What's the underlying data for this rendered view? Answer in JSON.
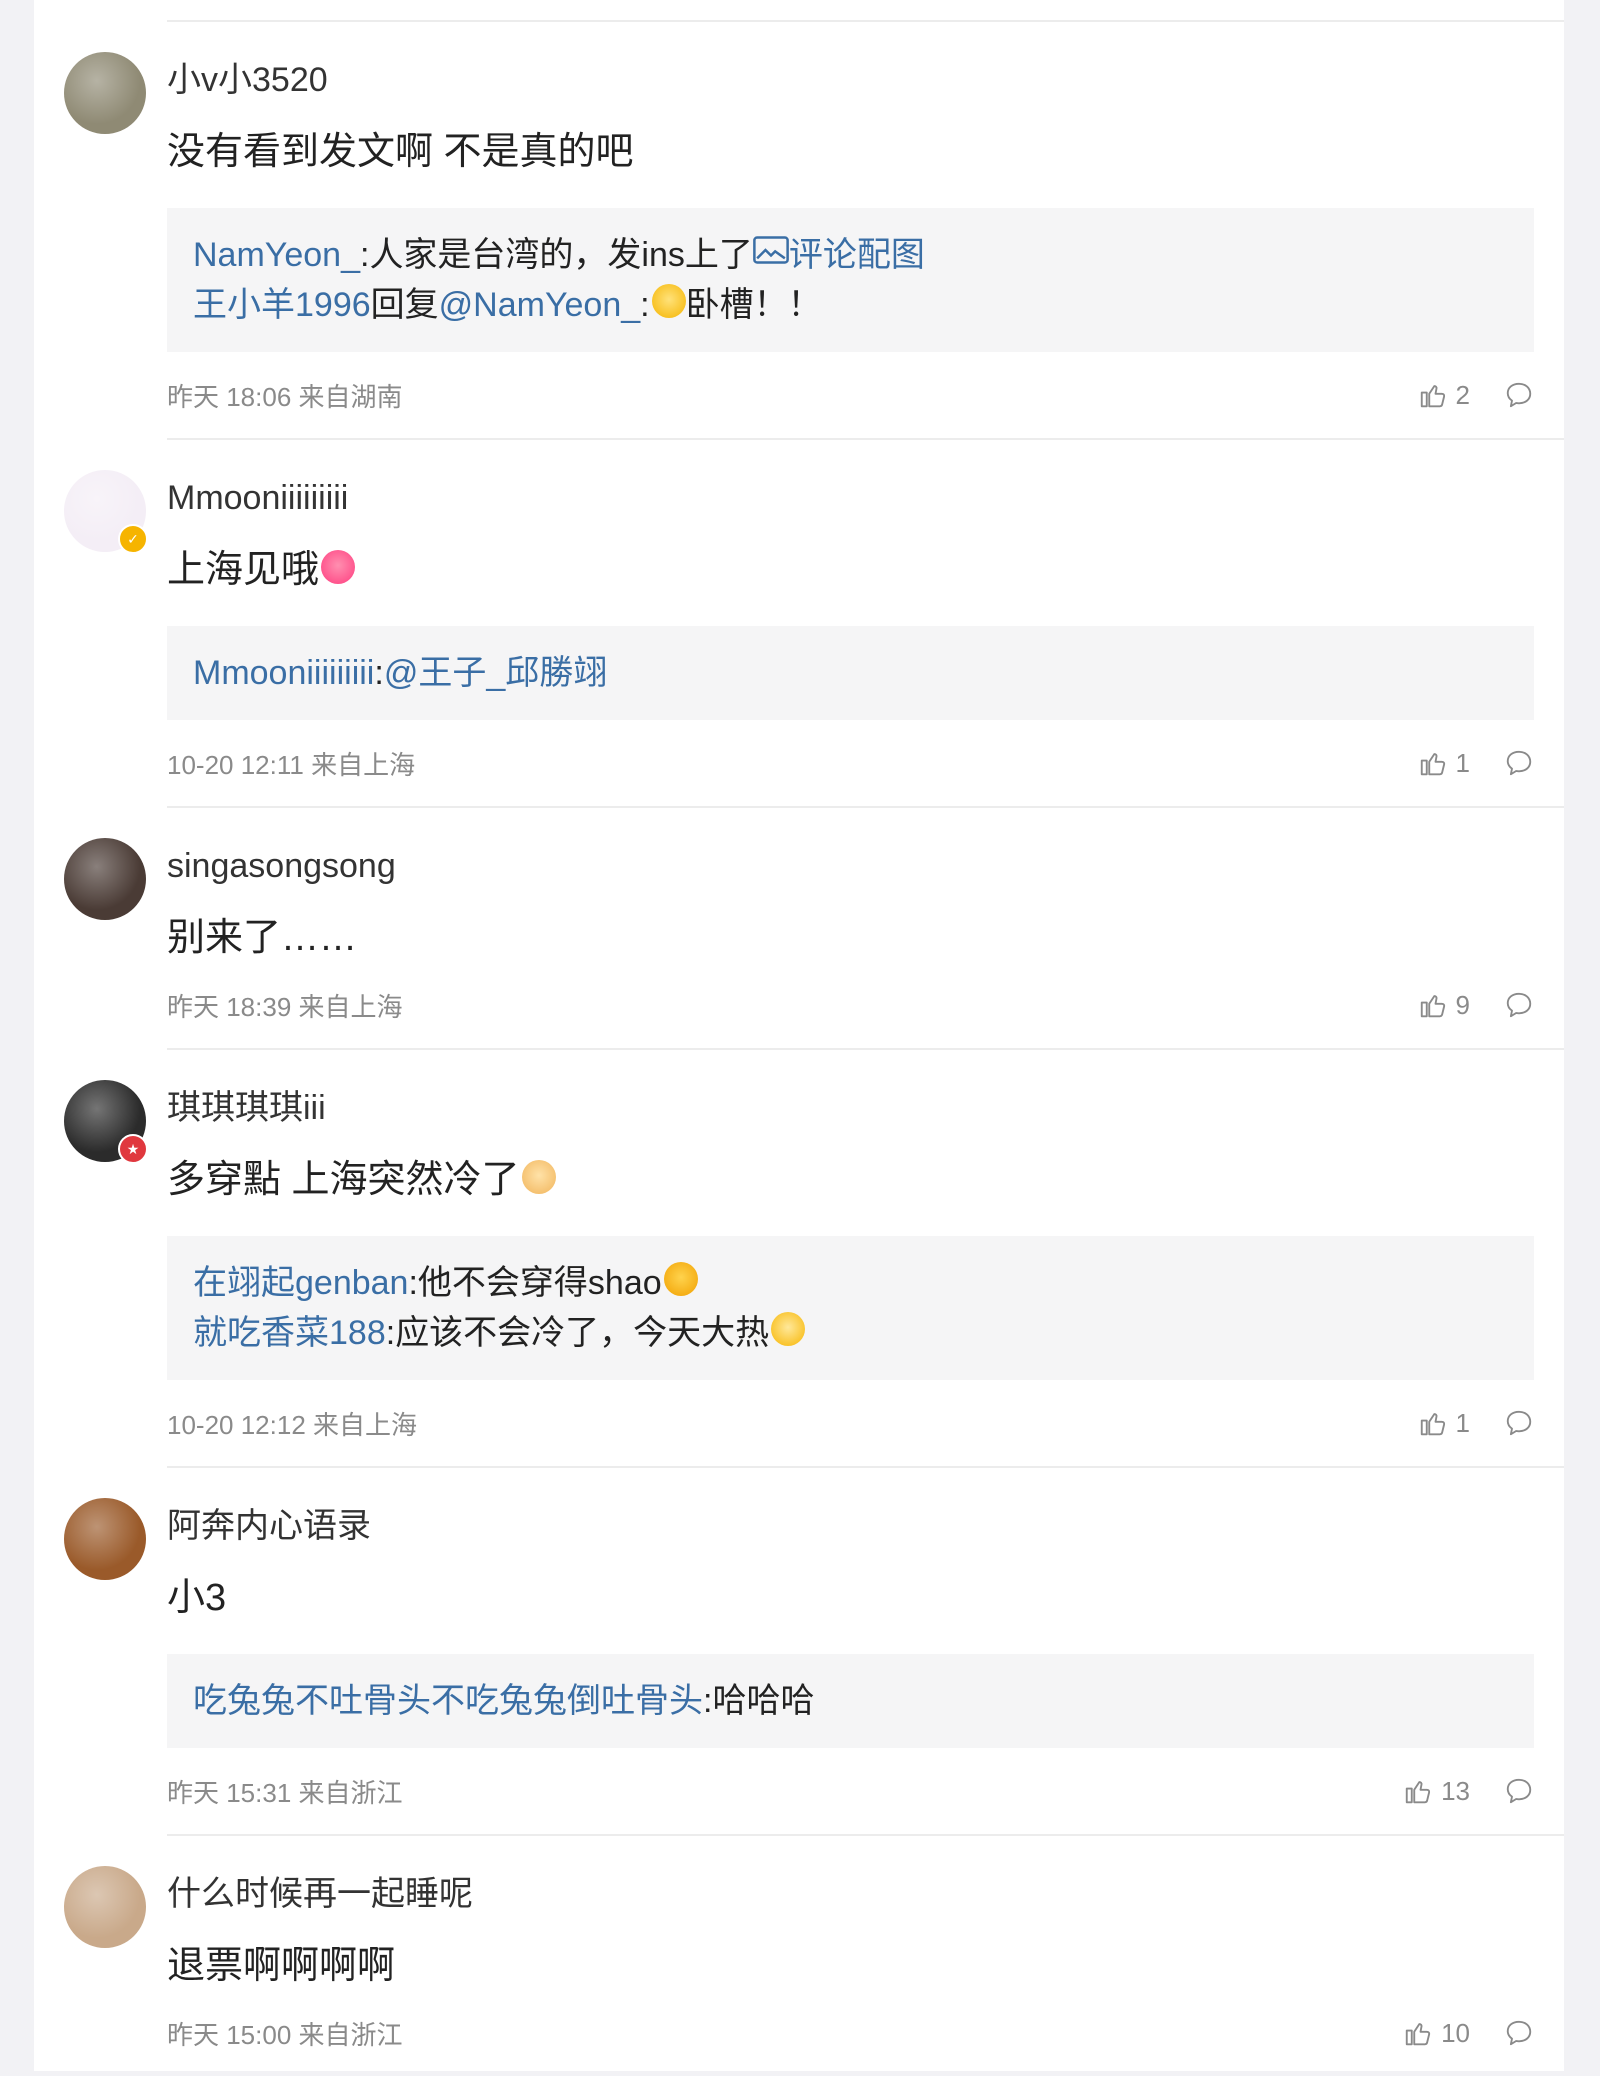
{
  "comments": [
    {
      "username": "小v小3520",
      "content": "没有看到发文啊 不是真的吧",
      "emoji": "",
      "badge": "",
      "avatar_color": "#8f8a74",
      "replies": [
        {
          "name": "NamYeon_",
          "sep": ":",
          "text": "人家是台湾的，发ins上了",
          "image_link": "评论配图",
          "emoji": ""
        },
        {
          "name": "王小羊1996",
          "sep": "",
          "text": "回复",
          "mention": "@NamYeon_",
          "after": ":",
          "emoji": "smile-emoji",
          "tail": "卧槽！！"
        }
      ],
      "time": "昨天 18:06",
      "location": "来自湖南",
      "likes": "2"
    },
    {
      "username": "Mmooniiiiiiiii",
      "content": "上海见哦",
      "emoji": "heart-face-emoji",
      "badge": "gold",
      "avatar_color": "#f4eef6",
      "replies": [
        {
          "name": "Mmooniiiiiiiii",
          "sep": ":",
          "text": "",
          "mention": "@王子_邱勝翊",
          "emoji": ""
        }
      ],
      "time": "10-20 12:11",
      "location": "来自上海",
      "likes": "1"
    },
    {
      "username": "singasongsong",
      "content": "别来了……",
      "emoji": "",
      "badge": "",
      "avatar_color": "#4a3b35",
      "replies": [],
      "time": "昨天 18:39",
      "location": "来自上海",
      "likes": "9"
    },
    {
      "username": "琪琪琪琪iii",
      "content": "多穿點 上海突然冷了",
      "emoji": "dog-emoji",
      "badge": "red",
      "avatar_color": "#2b2b2b",
      "replies": [
        {
          "name": "在翊起genban",
          "sep": ":",
          "text": "他不会穿得shao",
          "emoji": "heart-eyes-emoji"
        },
        {
          "name": "就吃香菜188",
          "sep": ":",
          "text": "应该不会冷了，今天大热",
          "emoji": "star-emoji"
        }
      ],
      "time": "10-20 12:12",
      "location": "来自上海",
      "likes": "1"
    },
    {
      "username": "阿奔内心语录",
      "content": "小3",
      "emoji": "",
      "badge": "",
      "avatar_color": "#9a5a2a",
      "replies": [
        {
          "name": "吃兔兔不吐骨头不吃兔兔倒吐骨头",
          "sep": ":",
          "text": "哈哈哈",
          "emoji": ""
        }
      ],
      "time": "昨天 15:31",
      "location": "来自浙江",
      "likes": "13"
    },
    {
      "username": "什么时候再一起睡呢",
      "content": "退票啊啊啊啊",
      "emoji": "",
      "badge": "",
      "avatar_color": "#c9a98a",
      "replies": [],
      "time": "昨天 15:00",
      "location": "来自浙江",
      "likes": "10"
    }
  ]
}
